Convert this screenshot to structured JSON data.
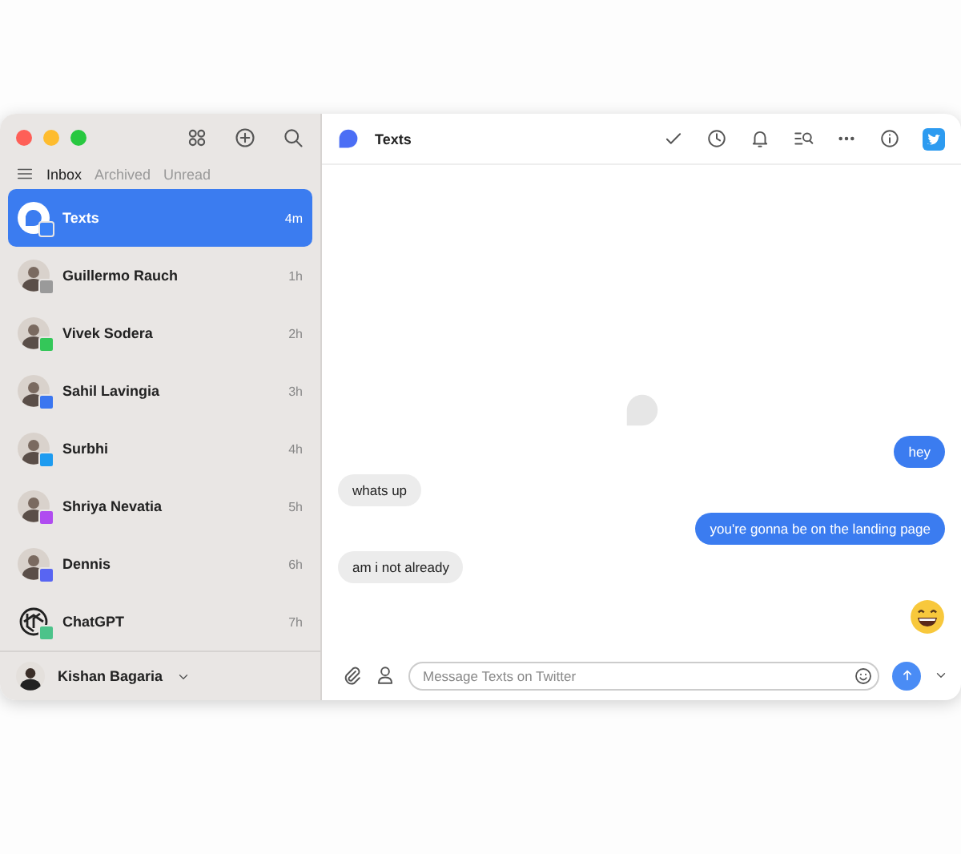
{
  "sidebar": {
    "tabs": [
      {
        "label": "Inbox",
        "selected": true
      },
      {
        "label": "Archived",
        "selected": false
      },
      {
        "label": "Unread",
        "selected": false
      }
    ],
    "chats": [
      {
        "name": "Texts",
        "time": "4m",
        "selected": true,
        "kind": "texts-logo",
        "color": "#3b82f6"
      },
      {
        "name": "Guillermo Rauch",
        "time": "1h",
        "selected": false,
        "kind": "person",
        "color": "#9a9a9a"
      },
      {
        "name": "Vivek Sodera",
        "time": "2h",
        "selected": false,
        "kind": "person",
        "color": "#34c759"
      },
      {
        "name": "Sahil Lavingia",
        "time": "3h",
        "selected": false,
        "kind": "person",
        "color": "#3a76f0"
      },
      {
        "name": "Surbhi",
        "time": "4h",
        "selected": false,
        "kind": "person",
        "color": "#1d9bf0"
      },
      {
        "name": "Shriya Nevatia",
        "time": "5h",
        "selected": false,
        "kind": "person",
        "color": "#b04cf0"
      },
      {
        "name": "Dennis",
        "time": "6h",
        "selected": false,
        "kind": "person",
        "color": "#5865f2"
      },
      {
        "name": "ChatGPT",
        "time": "7h",
        "selected": false,
        "kind": "chatgpt-logo",
        "color": "#4cc38a"
      }
    ],
    "account": {
      "name": "Kishan Bagaria"
    }
  },
  "conversation": {
    "title": "Texts",
    "messages": [
      {
        "kind": "text",
        "outgoing": true,
        "text": "hey"
      },
      {
        "kind": "text",
        "outgoing": false,
        "text": "whats up"
      },
      {
        "kind": "text",
        "outgoing": true,
        "text": "you're gonna be on the landing page"
      },
      {
        "kind": "text",
        "outgoing": false,
        "text": "am i not already"
      },
      {
        "kind": "emoji",
        "outgoing": true
      }
    ],
    "composer": {
      "placeholder": "Message Texts on Twitter"
    }
  }
}
